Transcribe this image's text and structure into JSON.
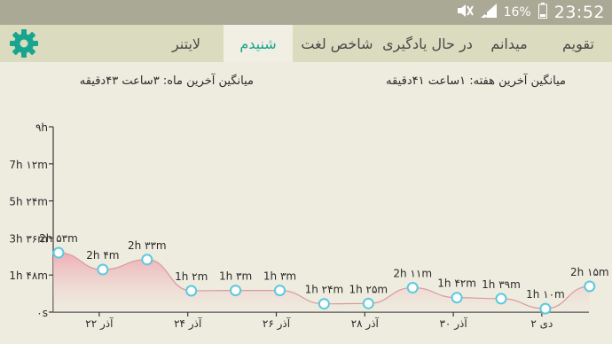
{
  "status_bar": {
    "icons": [
      "mute-icon",
      "signal-icon",
      "battery-icon"
    ],
    "battery": "16%",
    "time": "23:52"
  },
  "app_bar": {
    "settings_icon": "gear-icon",
    "tabs": [
      {
        "label": "تقویم",
        "active": false
      },
      {
        "label": "میدانم",
        "active": false
      },
      {
        "label": "در حال یادگیری",
        "active": false
      },
      {
        "label": "شاخص لغت",
        "active": false
      },
      {
        "label": "شنیدم",
        "active": true
      },
      {
        "label": "لایتنر",
        "active": false
      }
    ],
    "accent_color": "#18a58f"
  },
  "summary": {
    "last_week_avg": "میانگین آخرین هفته: ۱ساعت ۴۱دقیقه",
    "last_month_avg": "میانگین آخرین ماه: ۳ساعت ۴۳دقیقه"
  },
  "chart_data": {
    "type": "area",
    "y_ticks": [
      "۰s",
      "1h ۴۸m",
      "3h ۳۶m",
      "5h ۲۴m",
      "7h ۱۲m",
      "۹h"
    ],
    "y_tick_minutes": [
      0,
      108,
      216,
      324,
      432,
      540
    ],
    "ylim_minutes": [
      0,
      540
    ],
    "x_tick_labels": [
      "۲۲ آذر",
      "۲۴ آذر",
      "۲۶ آذر",
      "۲۸ آذر",
      "۳۰ آذر",
      "۲ دی"
    ],
    "points": [
      {
        "label": "2h ۵۳m",
        "minutes": 173
      },
      {
        "label": "2h ۴m",
        "minutes": 124
      },
      {
        "label": "2h ۳۳m",
        "minutes": 153
      },
      {
        "label": "1h ۲m",
        "minutes": 62
      },
      {
        "label": "1h ۳m",
        "minutes": 63
      },
      {
        "label": "1h ۳m",
        "minutes": 63
      },
      {
        "label": "1h ۲۴m",
        "minutes": 24
      },
      {
        "label": "1h ۲۵m",
        "minutes": 25
      },
      {
        "label": "2h ۱۱m",
        "minutes": 71
      },
      {
        "label": "1h ۴۲m",
        "minutes": 42
      },
      {
        "label": "1h ۳۹m",
        "minutes": 39
      },
      {
        "label": "1h ۱۰m",
        "minutes": 10
      },
      {
        "label": "2h ۱۵m",
        "minutes": 75
      }
    ],
    "fill_color": "#f2b7bc",
    "point_color": "#5bc9df",
    "line_color": "#d99aa0"
  }
}
